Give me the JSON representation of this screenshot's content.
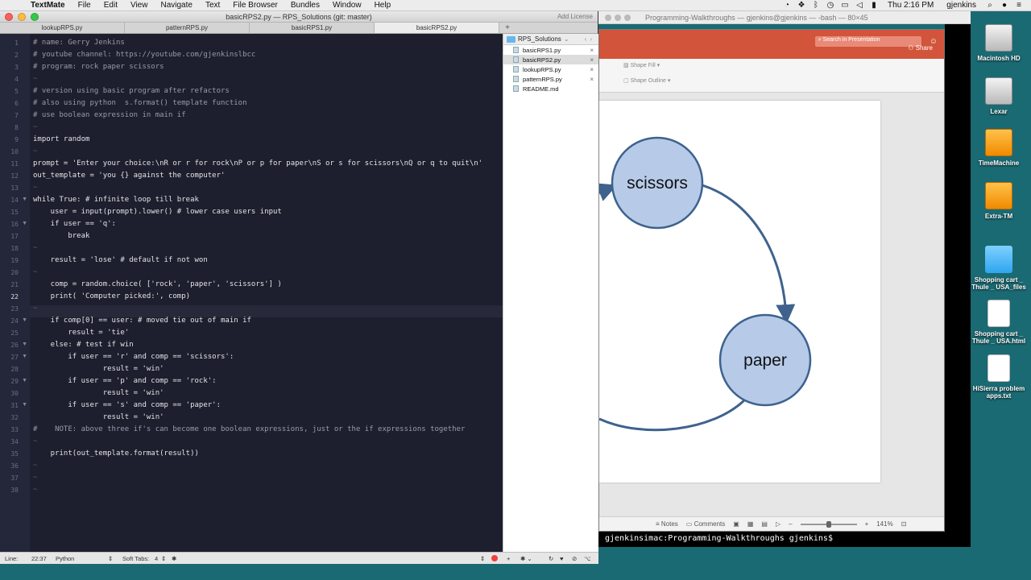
{
  "menubar": {
    "app": "TextMate",
    "items": [
      "File",
      "Edit",
      "View",
      "Navigate",
      "Text",
      "File Browser",
      "Bundles",
      "Window",
      "Help"
    ],
    "clock": "Thu 2:16 PM",
    "user": "gjenkins",
    "icons": [
      "wifi-icon",
      "dropbox-icon",
      "bluetooth-icon",
      "time-machine-icon",
      "display-icon",
      "volume-icon",
      "battery-icon",
      "spotlight-icon",
      "siri-icon",
      "notification-icon"
    ]
  },
  "desktop": {
    "items": [
      "Macintosh HD",
      "Lexar",
      "TimeMachine",
      "Extra-TM",
      "Shopping cart _ Thule _ USA_files",
      "Shopping cart _ Thule _ USA.html",
      "HiSierra problem apps.txt"
    ]
  },
  "terminal": {
    "title": "Programming-Walkthroughs — gjenkins@gjenkins — -bash — 80×45",
    "prompt": "gjenkinsimac:Programming-Walkthroughs gjenkins$ ",
    "peek": "D o   :  o  o"
  },
  "ppt": {
    "search_placeholder": "Search in Presentation",
    "share": "Share",
    "ribbon": {
      "shape_fill": "Shape Fill",
      "shape_outline": "Shape Outline"
    },
    "slide": {
      "node1": "scissors",
      "node2": "paper"
    },
    "status": {
      "notes": "Notes",
      "comments": "Comments",
      "zoom": "141%"
    }
  },
  "textmate": {
    "title": "basicRPS2.py — RPS_Solutions (git: master)",
    "add_license": "Add License",
    "tabs": [
      "lookupRPS.py",
      "patternRPS.py",
      "basicRPS1.py",
      "basicRPS2.py"
    ],
    "active_tab": 3,
    "current_line": 22,
    "code": [
      "# name: Gerry Jenkins",
      "# youtube channel: https://youtube.com/gjenkinslbcc",
      "# program: rock paper scissors",
      "~",
      "# version using basic program after refactors",
      "# also using python  s.format() template function",
      "# use boolean expression in main if",
      "~",
      "import random",
      "~",
      "prompt = 'Enter your choice:\\nR or r for rock\\nP or p for paper\\nS or s for scissors\\nQ or q to quit\\n'",
      "out_template = 'you {} against the computer'",
      "~",
      "while True: # infinite loop till break",
      "    user = input(prompt).lower() # lower case users input",
      "    if user == 'q':",
      "        break",
      "~",
      "    result = 'lose' # default if not won",
      "~",
      "    comp = random.choice( ['rock', 'paper', 'scissors'] )",
      "    print( 'Computer picked:', comp)",
      "~",
      "    if comp[0] == user: # moved tie out of main if",
      "        result = 'tie'",
      "    else: # test if win",
      "        if user == 'r' and comp == 'scissors':",
      "                result = 'win'",
      "        if user == 'p' and comp == 'rock':",
      "                result = 'win'",
      "        if user == 's' and comp == 'paper':",
      "                result = 'win'",
      "#    NOTE: above three if's can become one boolean expressions, just or the if expressions together",
      "~",
      "    print(out_template.format(result))",
      "~",
      "~",
      "~"
    ],
    "drawer": {
      "project": "RPS_Solutions",
      "files": [
        "basicRPS1.py",
        "basicRPS2.py",
        "lookupRPS.py",
        "patternRPS.py",
        "README.md"
      ],
      "selected": 1
    },
    "status": {
      "line_label": "Line:",
      "position": "22:37",
      "language": "Python",
      "tabs": "Soft Tabs:",
      "tab_size": "4"
    }
  }
}
